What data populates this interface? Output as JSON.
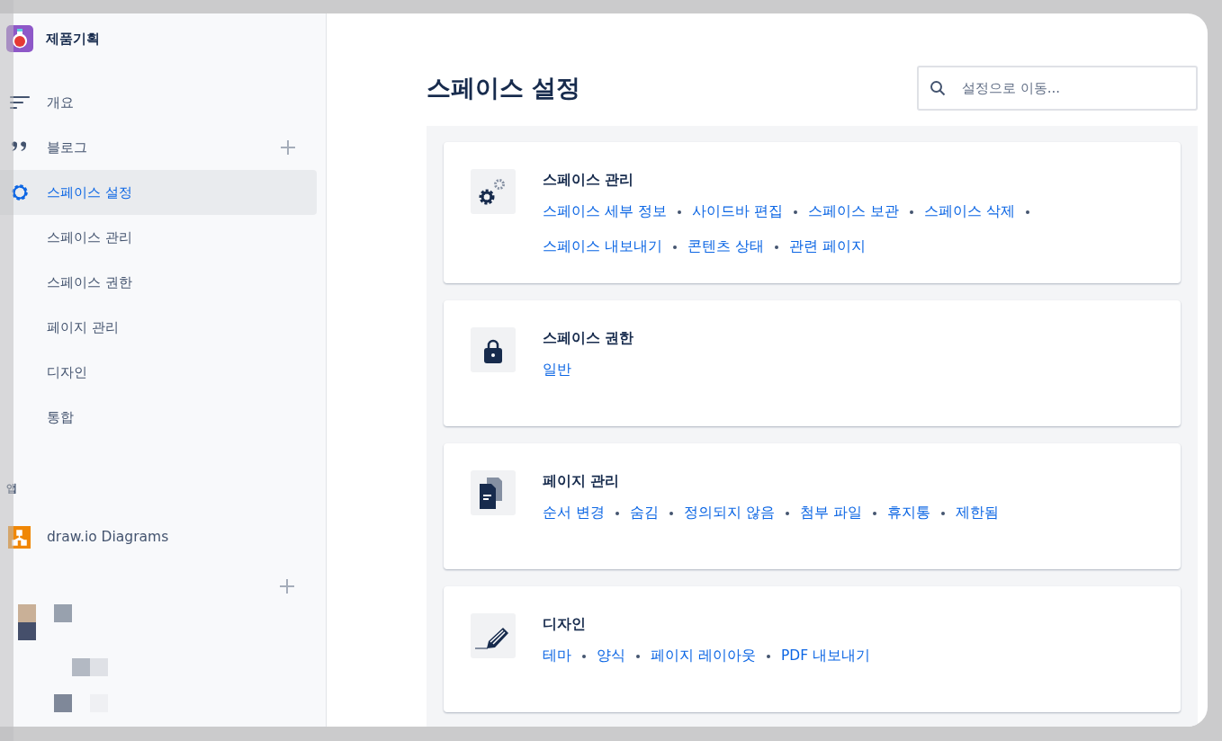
{
  "sidebar": {
    "space_name": "제품기획",
    "nav": [
      {
        "label": "개요",
        "selected": false,
        "addable": false
      },
      {
        "label": "블로그",
        "selected": false,
        "addable": true
      },
      {
        "label": "스페이스 설정",
        "selected": true,
        "addable": false
      }
    ],
    "sub_items": [
      "스페이스 관리",
      "스페이스 권한",
      "페이지 관리",
      "디자인",
      "통합"
    ],
    "apps_heading": "앱",
    "apps": [
      {
        "label": "draw.io Diagrams"
      }
    ]
  },
  "main": {
    "title": "스페이스 설정",
    "search": {
      "placeholder": "설정으로 이동..."
    },
    "cards": [
      {
        "title": "스페이스 관리",
        "links": [
          "스페이스 세부 정보",
          "사이드바 편집",
          "스페이스 보관",
          "스페이스 삭제",
          "스페이스 내보내기",
          "콘텐츠 상태",
          "관련 페이지"
        ]
      },
      {
        "title": "스페이스 권한",
        "links": [
          "일반"
        ]
      },
      {
        "title": "페이지 관리",
        "links": [
          "순서 변경",
          "숨김",
          "정의되지 않음",
          "첨부 파일",
          "휴지통",
          "제한됨"
        ]
      },
      {
        "title": "디자인",
        "links": [
          "테마",
          "양식",
          "페이지 레이아웃",
          "PDF 내보내기"
        ]
      }
    ]
  }
}
